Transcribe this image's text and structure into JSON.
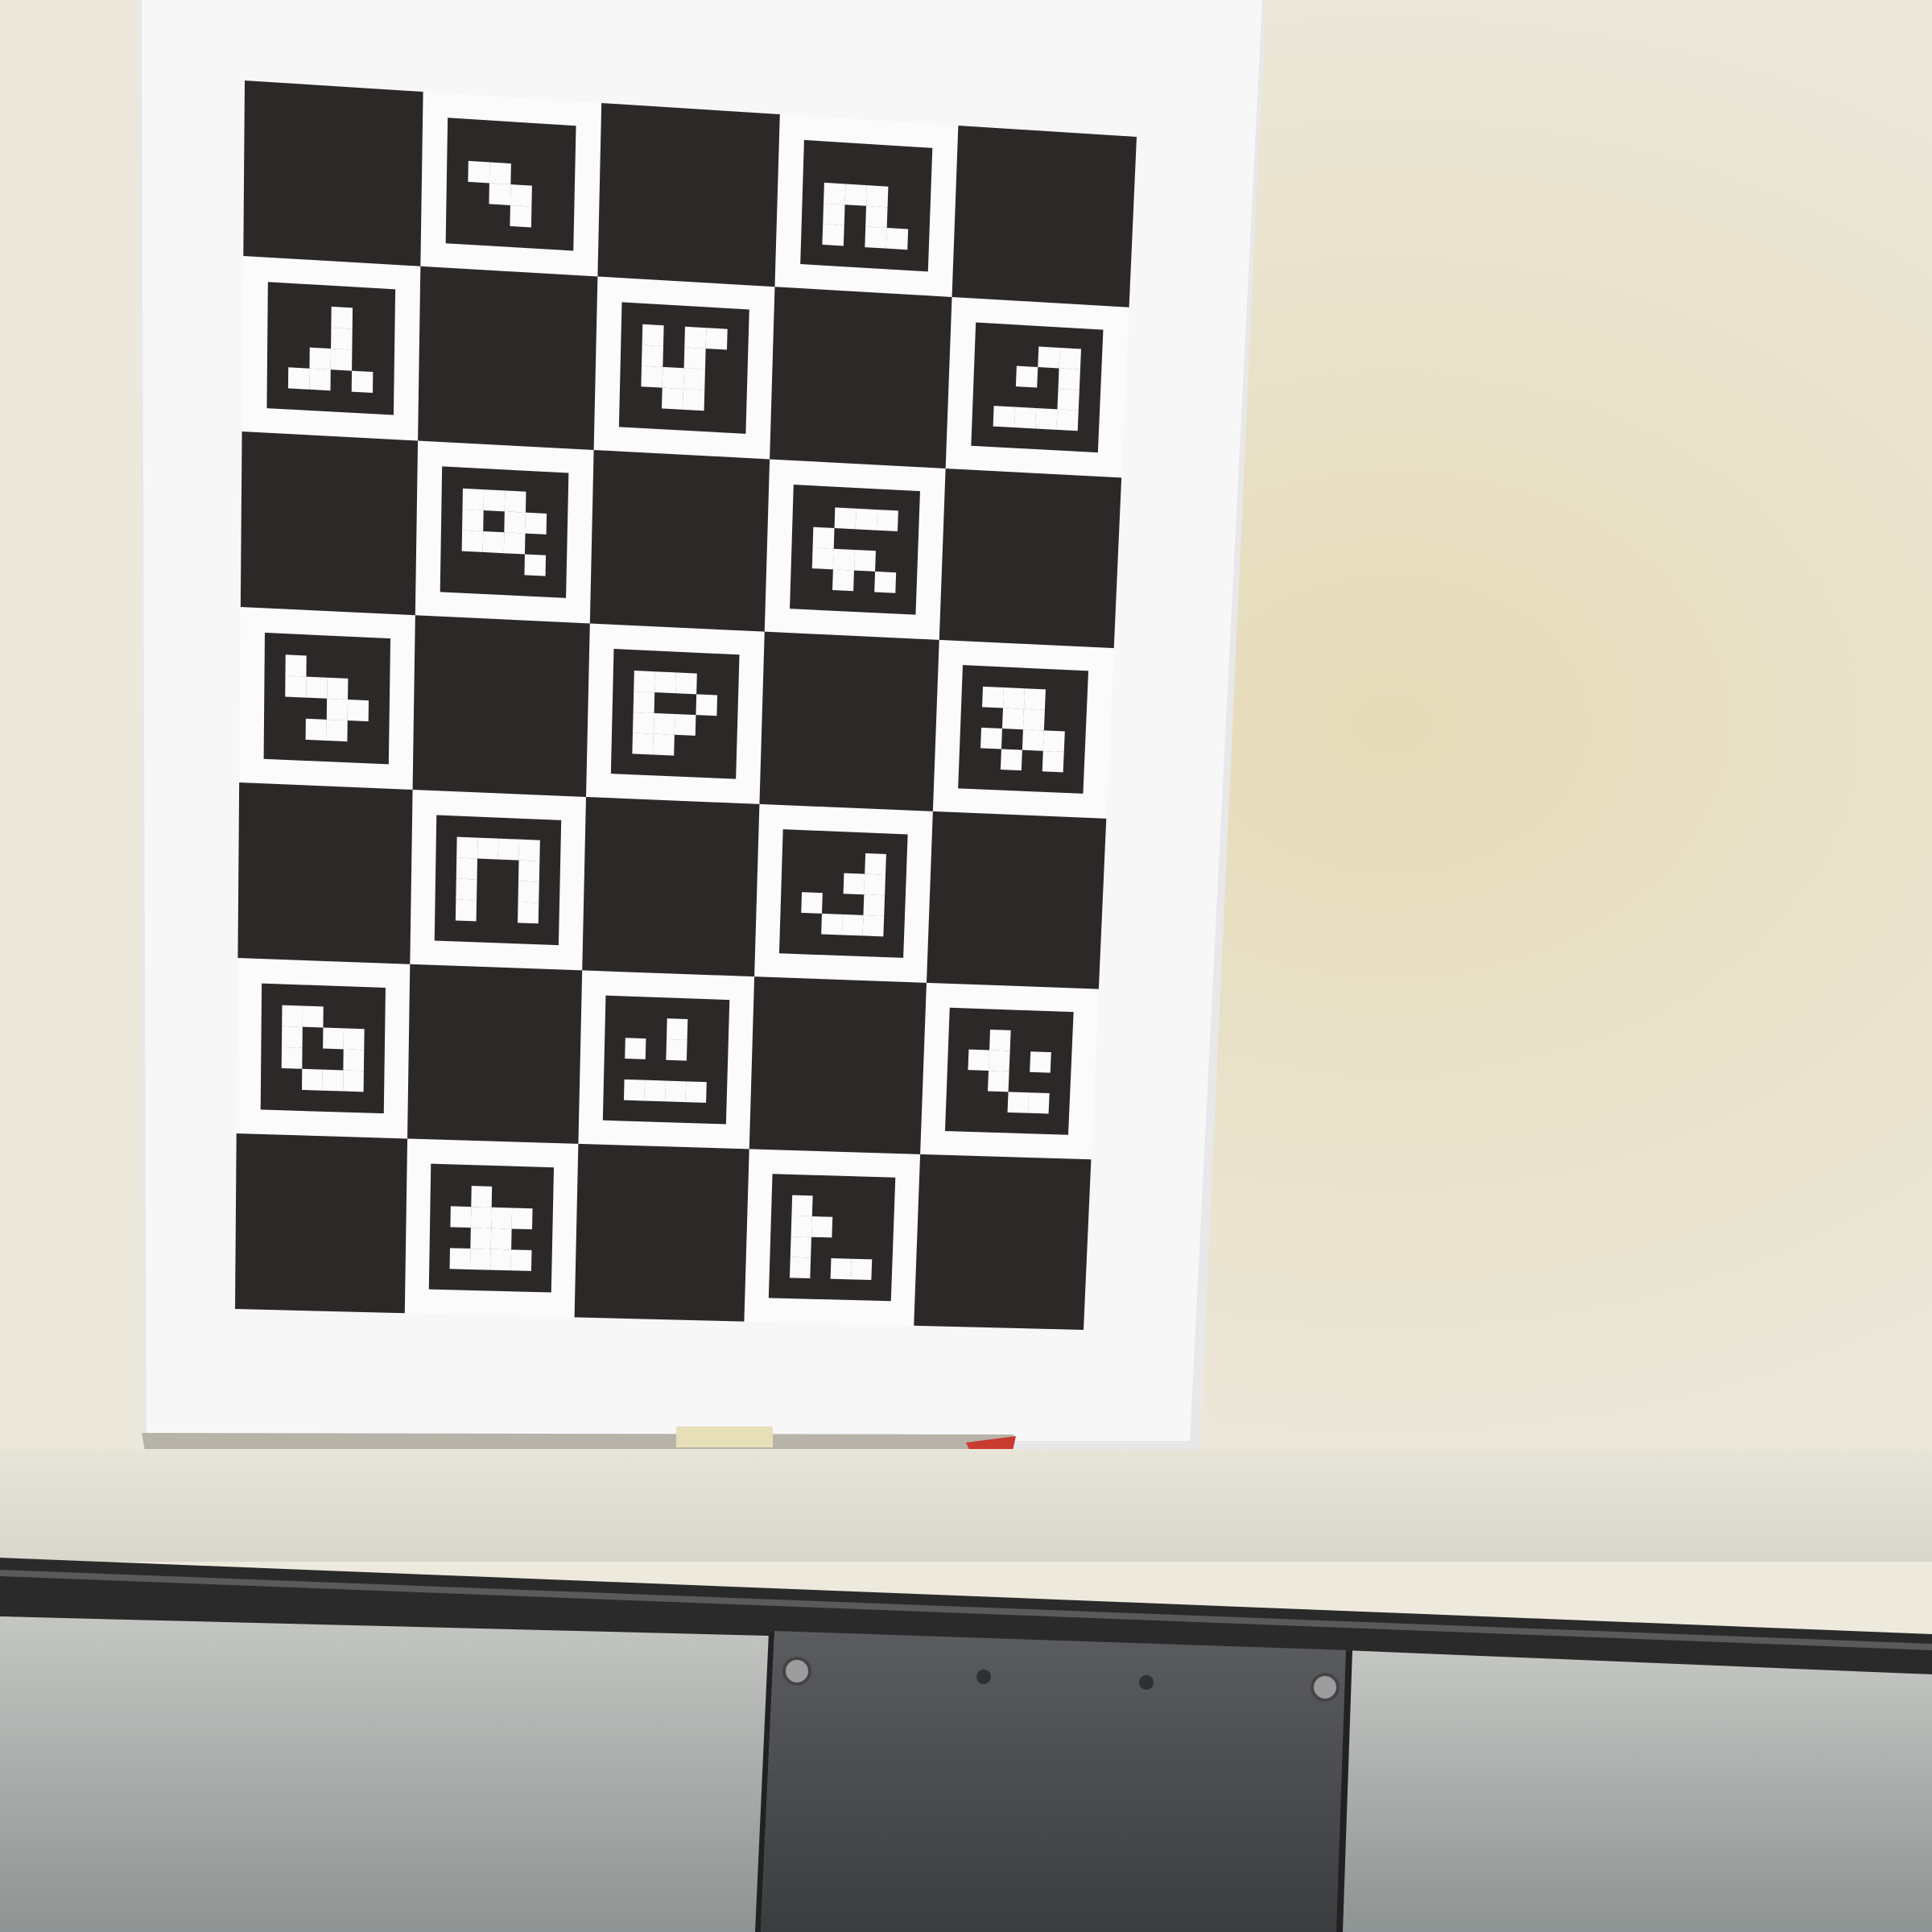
{
  "scene": {
    "description_free": true,
    "wall_color": "#ece8db",
    "wall_highlight": "#e9e1c3",
    "rail_color": "#2c2c2c",
    "panel_color": "#9fa4a2",
    "bracket_color": "#4a4d50",
    "board_dark": "#2d2828",
    "board_light": "#fbfbfb"
  },
  "board": {
    "rows": 7,
    "cols": 5,
    "marker_bits": 4,
    "markers": [
      [
        0,
        0,
        0,
        0,
        1,
        1,
        0,
        0,
        0,
        1,
        1,
        0,
        0,
        0,
        1,
        0
      ],
      [
        0,
        0,
        0,
        0,
        1,
        1,
        1,
        0,
        1,
        0,
        1,
        0,
        1,
        0,
        1,
        1
      ],
      [
        0,
        0,
        1,
        0,
        0,
        0,
        1,
        0,
        0,
        1,
        1,
        0,
        1,
        1,
        0,
        1
      ],
      [
        1,
        0,
        1,
        1,
        1,
        0,
        1,
        0,
        1,
        1,
        1,
        0,
        0,
        1,
        1,
        0
      ],
      [
        0,
        0,
        1,
        1,
        0,
        1,
        0,
        1,
        0,
        0,
        0,
        1,
        1,
        1,
        1,
        1
      ],
      [
        1,
        1,
        1,
        0,
        1,
        0,
        1,
        1,
        1,
        1,
        1,
        0,
        0,
        0,
        0,
        1
      ],
      [
        0,
        1,
        1,
        1,
        1,
        0,
        0,
        0,
        1,
        1,
        1,
        0,
        0,
        1,
        0,
        1
      ],
      [
        1,
        0,
        0,
        0,
        1,
        1,
        1,
        0,
        0,
        0,
        1,
        1,
        0,
        1,
        1,
        0
      ],
      [
        1,
        1,
        1,
        0,
        1,
        0,
        0,
        1,
        1,
        1,
        1,
        0,
        1,
        1,
        0,
        0
      ],
      [
        1,
        1,
        1,
        0,
        0,
        1,
        1,
        0,
        1,
        0,
        1,
        1,
        0,
        1,
        0,
        1
      ],
      [
        1,
        1,
        1,
        1,
        1,
        0,
        0,
        1,
        1,
        0,
        0,
        1,
        1,
        0,
        0,
        1
      ],
      [
        0,
        0,
        0,
        1,
        0,
        0,
        1,
        1,
        1,
        0,
        0,
        1,
        0,
        1,
        1,
        1
      ],
      [
        1,
        1,
        0,
        0,
        1,
        0,
        1,
        1,
        1,
        0,
        0,
        1,
        0,
        1,
        1,
        1
      ],
      [
        0,
        0,
        1,
        0,
        1,
        0,
        1,
        0,
        0,
        0,
        0,
        0,
        1,
        1,
        1,
        1
      ],
      [
        0,
        1,
        0,
        0,
        1,
        1,
        0,
        1,
        0,
        1,
        0,
        0,
        0,
        0,
        1,
        1
      ],
      [
        0,
        1,
        0,
        0,
        1,
        1,
        1,
        1,
        0,
        1,
        1,
        0,
        1,
        1,
        1,
        1
      ],
      [
        1,
        0,
        0,
        0,
        1,
        1,
        0,
        0,
        1,
        0,
        0,
        0,
        1,
        0,
        1,
        1
      ]
    ]
  }
}
